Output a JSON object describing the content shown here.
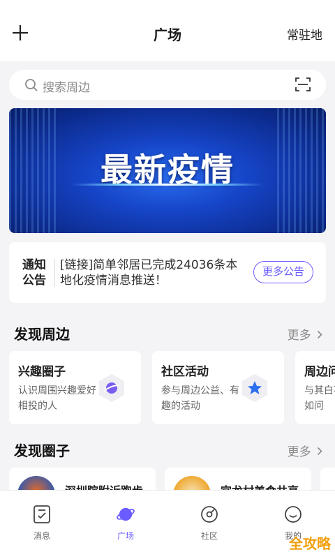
{
  "header": {
    "title": "广场",
    "right_label": "常驻地"
  },
  "search": {
    "placeholder": "搜索周边"
  },
  "banner": {
    "text": "最新疫情"
  },
  "notice": {
    "tag_line1": "通知",
    "tag_line2": "公告",
    "message": "[链接]简单邻居已完成24036条本地化疫情消息推送！",
    "more_label": "更多公告"
  },
  "discover_nearby": {
    "title": "发现周边",
    "more_label": "更多",
    "cards": [
      {
        "title": "兴趣圈子",
        "desc": "认识周围兴趣爱好相投的人",
        "icon": "planet-icon"
      },
      {
        "title": "社区活动",
        "desc": "参与周边公益、有趣的活动",
        "icon": "star-icon"
      },
      {
        "title": "周边问",
        "desc": "与其白不如问",
        "icon": "question-icon"
      }
    ]
  },
  "discover_circles": {
    "title": "发现圈子",
    "more_label": "更多",
    "items": [
      {
        "name": "深圳院附近跑步"
      },
      {
        "name": "宜龙村美食共享"
      }
    ]
  },
  "tabbar": {
    "items": [
      {
        "label": "消息",
        "icon": "message-icon",
        "active": false
      },
      {
        "label": "广场",
        "icon": "planet-icon",
        "active": true
      },
      {
        "label": "社区",
        "icon": "community-icon",
        "active": false
      },
      {
        "label": "我的",
        "icon": "smile-icon",
        "active": false
      }
    ]
  },
  "watermark": "全攻略",
  "colors": {
    "accent": "#6b5cff",
    "banner_blue": "#1645c8",
    "background": "#f4f4f6"
  }
}
